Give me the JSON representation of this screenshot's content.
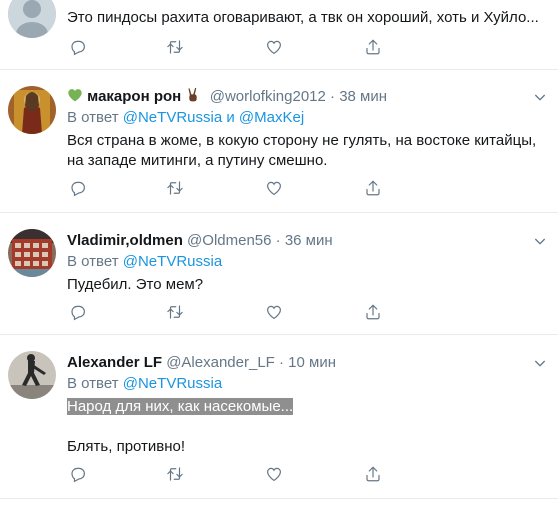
{
  "tweets": [
    {
      "text": "Это пиндосы рахита оговаривают, а твк он хороший, хоть и Хуйло..."
    },
    {
      "name": "макарон рон",
      "handle": "@worlofking2012",
      "dot": "·",
      "time": "38 мин",
      "reply_prefix": "В ответ",
      "mention1": "@NeTVRussia",
      "and": "и",
      "mention2": "@MaxKej",
      "line1": "Вся страна в жоме, в кокую сторону не гулять, на востоке китайцы,",
      "line2": "на западе митинги, а путину смешно."
    },
    {
      "name": "Vladimir,oldmen",
      "handle": "@Oldmen56",
      "dot": "·",
      "time": "36 мин",
      "reply_prefix": "В ответ",
      "mention1": "@NeTVRussia",
      "line1": "Пудебил. Это мем?"
    },
    {
      "name": "Alexander LF",
      "handle": "@Alexander_LF",
      "dot": "·",
      "time": "10 мин",
      "reply_prefix": "В ответ",
      "mention1": "@NeTVRussia",
      "line1": "Народ для них, как насекомые...",
      "line2": "Блять, противно!"
    }
  ],
  "colors": {
    "link": "#1b95e0",
    "secondary": "#657786",
    "divider": "#e6ecf0",
    "heart_green": "#77b255"
  },
  "icons": {
    "reply": "reply-icon",
    "retweet": "retweet-icon",
    "like": "like-icon",
    "share": "share-icon",
    "caret": "chevron-down-icon"
  }
}
